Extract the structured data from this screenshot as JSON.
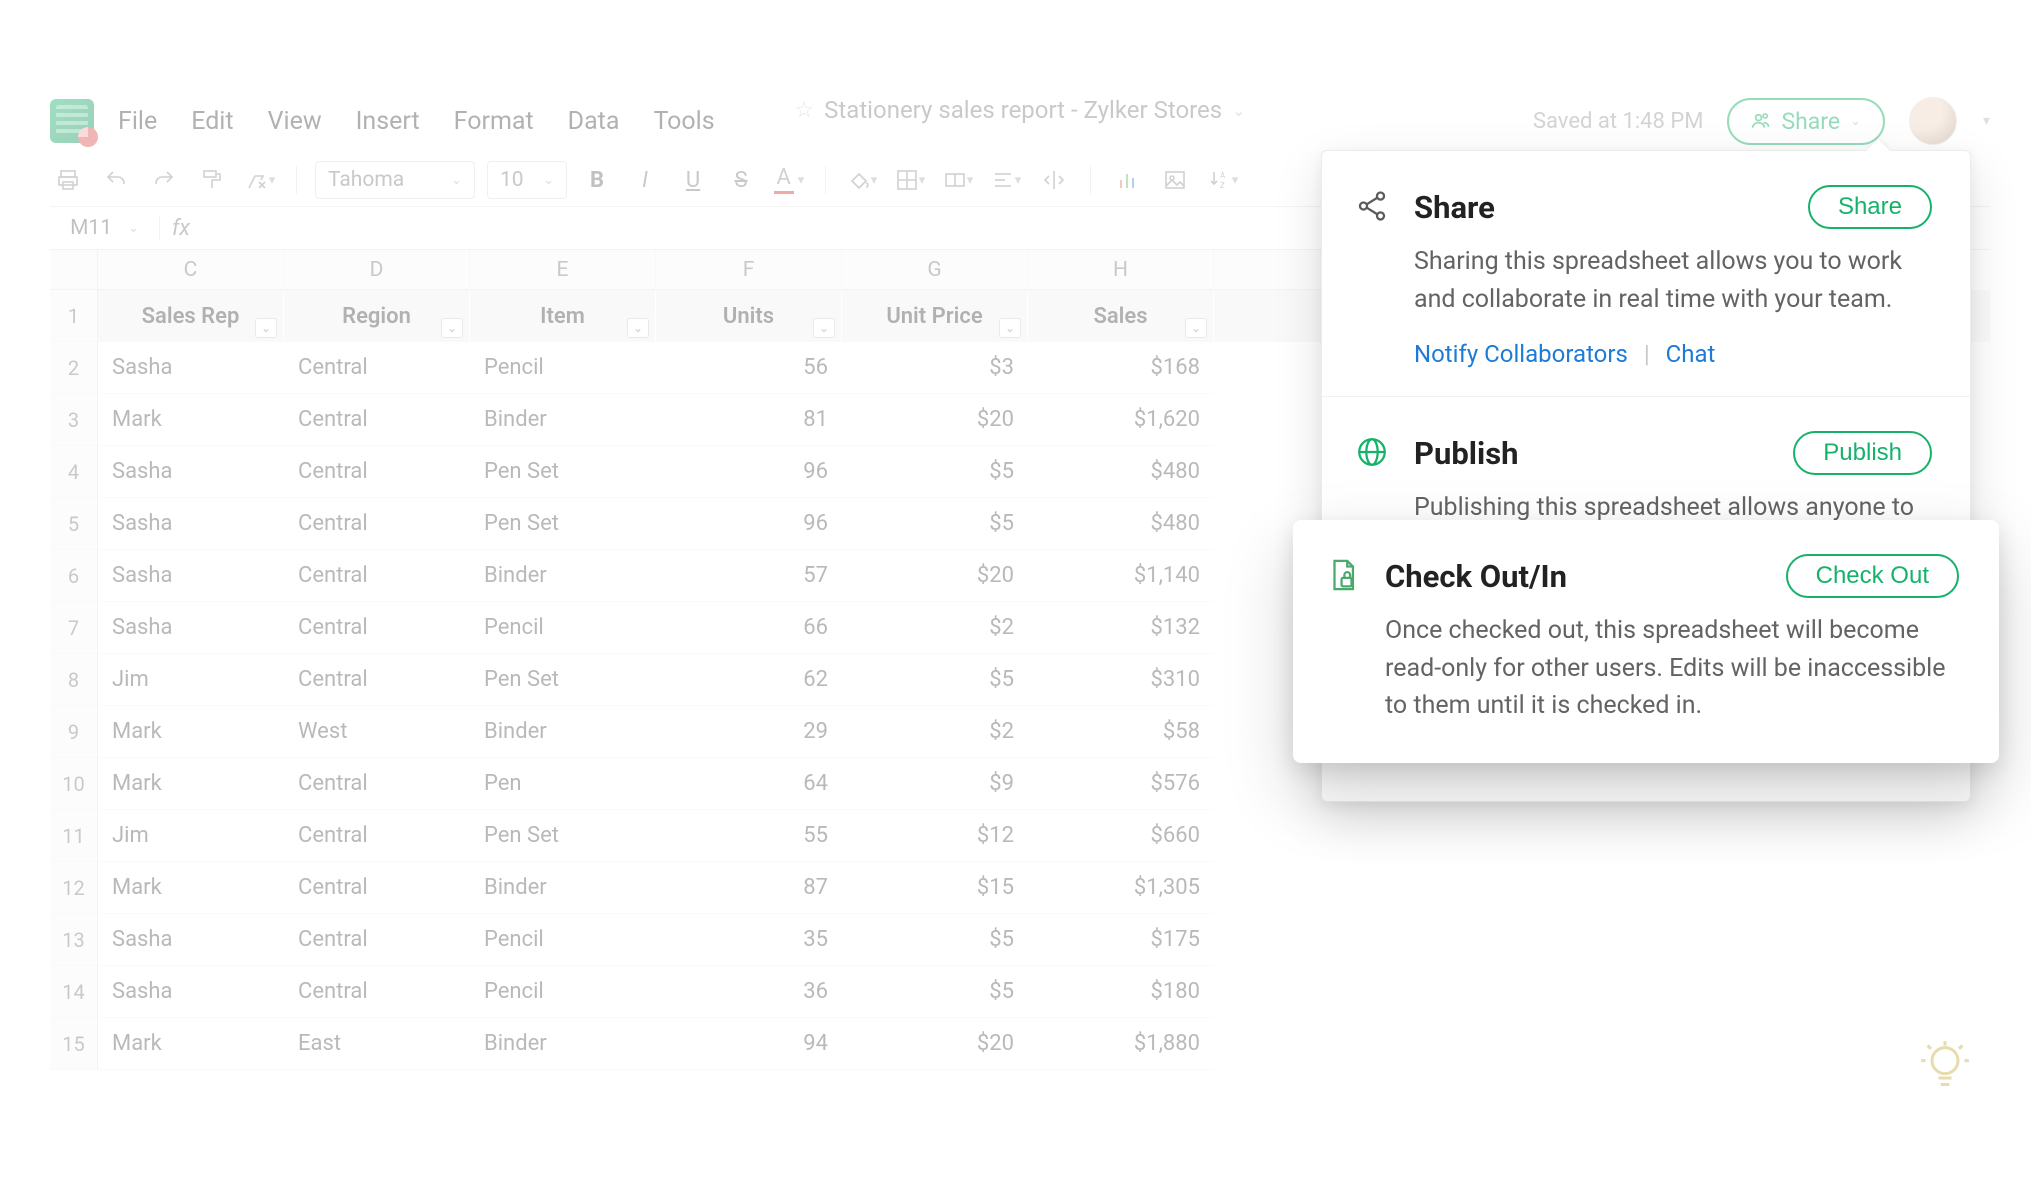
{
  "doc": {
    "title": "Stationery sales report - Zylker Stores",
    "saved_status": "Saved at 1:48 PM"
  },
  "menubar": [
    "File",
    "Edit",
    "View",
    "Insert",
    "Format",
    "Data",
    "Tools"
  ],
  "share_button_label": "Share",
  "toolbar": {
    "font_family": "Tahoma",
    "font_size": "10",
    "bold": "B",
    "italic": "I",
    "underline": "U",
    "strike": "S",
    "font_color": "A"
  },
  "name_box": "M11",
  "fx_label": "fx",
  "column_letters": [
    "C",
    "D",
    "E",
    "F",
    "G",
    "H",
    ""
  ],
  "headers": [
    "Sales Rep",
    "Region",
    "Item",
    "Units",
    "Unit Price",
    "Sales"
  ],
  "rows": [
    {
      "n": "1"
    },
    {
      "n": "2",
      "rep": "Sasha",
      "region": "Central",
      "item": "Pencil",
      "units": "56",
      "price": "$3",
      "sales": "$168"
    },
    {
      "n": "3",
      "rep": "Mark",
      "region": "Central",
      "item": "Binder",
      "units": "81",
      "price": "$20",
      "sales": "$1,620"
    },
    {
      "n": "4",
      "rep": "Sasha",
      "region": "Central",
      "item": "Pen Set",
      "units": "96",
      "price": "$5",
      "sales": "$480"
    },
    {
      "n": "5",
      "rep": "Sasha",
      "region": "Central",
      "item": "Pen Set",
      "units": "96",
      "price": "$5",
      "sales": "$480"
    },
    {
      "n": "6",
      "rep": "Sasha",
      "region": "Central",
      "item": "Binder",
      "units": "57",
      "price": "$20",
      "sales": "$1,140"
    },
    {
      "n": "7",
      "rep": "Sasha",
      "region": "Central",
      "item": "Pencil",
      "units": "66",
      "price": "$2",
      "sales": "$132"
    },
    {
      "n": "8",
      "rep": "Jim",
      "region": "Central",
      "item": "Pen Set",
      "units": "62",
      "price": "$5",
      "sales": "$310"
    },
    {
      "n": "9",
      "rep": "Mark",
      "region": "West",
      "item": "Binder",
      "units": "29",
      "price": "$2",
      "sales": "$58"
    },
    {
      "n": "10",
      "rep": "Mark",
      "region": "Central",
      "item": "Pen",
      "units": "64",
      "price": "$9",
      "sales": "$576"
    },
    {
      "n": "11",
      "rep": "Jim",
      "region": "Central",
      "item": "Pen Set",
      "units": "55",
      "price": "$12",
      "sales": "$660"
    },
    {
      "n": "12",
      "rep": "Mark",
      "region": "Central",
      "item": "Binder",
      "units": "87",
      "price": "$15",
      "sales": "$1,305"
    },
    {
      "n": "13",
      "rep": "Sasha",
      "region": "Central",
      "item": "Pencil",
      "units": "35",
      "price": "$5",
      "sales": "$175"
    },
    {
      "n": "14",
      "rep": "Sasha",
      "region": "Central",
      "item": "Pencil",
      "units": "36",
      "price": "$5",
      "sales": "$180"
    },
    {
      "n": "15",
      "rep": "Mark",
      "region": "East",
      "item": "Binder",
      "units": "94",
      "price": "$20",
      "sales": "$1,880"
    }
  ],
  "panel": {
    "share": {
      "title": "Share",
      "button": "Share",
      "desc": "Sharing this spreadsheet allows you to work and collaborate in real time with your team.",
      "link_notify": "Notify Collaborators",
      "link_chat": "Chat"
    },
    "publish": {
      "title": "Publish",
      "button": "Publish",
      "desc": "Publishing this spreadsheet allows anyone to view it. You can also embed this spreadsheet in your blogs, forums, or websites!"
    },
    "checkout": {
      "title": "Check Out/In",
      "button": "Check Out",
      "desc": "Once checked out, this spreadsheet will become read-only for other users. Edits will be inaccessible to them until it is checked in."
    }
  }
}
